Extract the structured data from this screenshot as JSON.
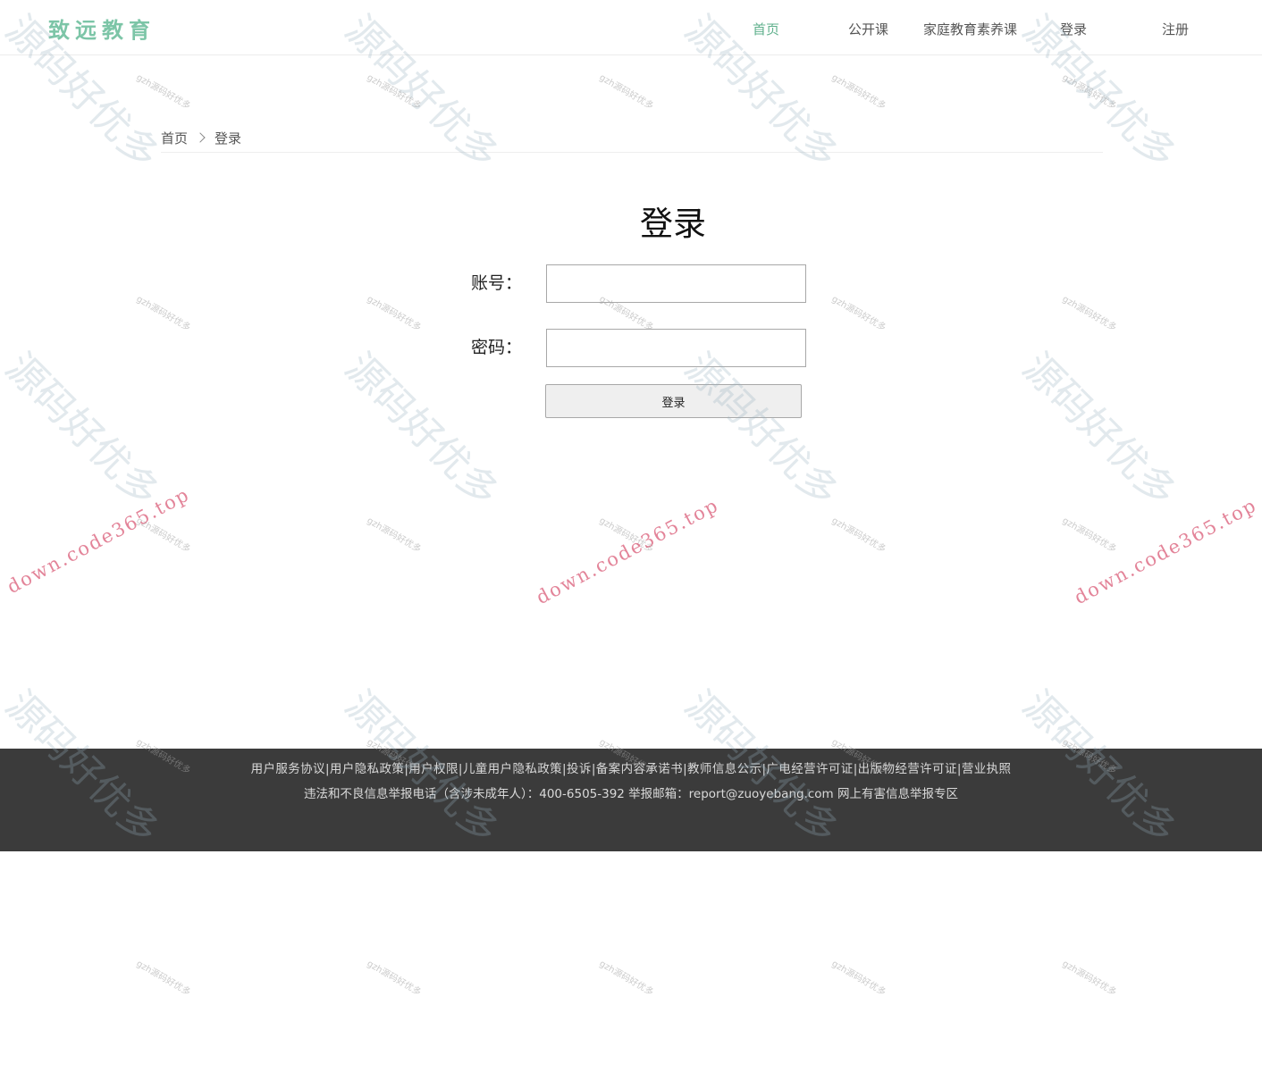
{
  "header": {
    "logo": "致远教育",
    "nav": [
      {
        "label": "首页",
        "active": true
      },
      {
        "label": "公开课",
        "active": false
      },
      {
        "label": "家庭教育素养课",
        "active": false
      },
      {
        "label": "登录",
        "active": false
      },
      {
        "label": "注册",
        "active": false
      }
    ]
  },
  "breadcrumb": {
    "home": "首页",
    "current": "登录"
  },
  "login": {
    "title": "登录",
    "account_label": "账号：",
    "account_value": "",
    "password_label": "密码：",
    "password_value": "",
    "submit_label": "登录"
  },
  "footer": {
    "links": [
      "用户服务协议",
      "用户隐私政策",
      "用户权限",
      "儿童用户隐私政策",
      "投诉",
      "备案内容承诺书",
      "教师信息公示",
      "广电经营许可证",
      "出版物经营许可证",
      "营业执照"
    ],
    "separator": "|",
    "info": "违法和不良信息举报电话（含涉未成年人）：400-6505-392 举报邮箱：report@zuoyebang.com 网上有害信息举报专区"
  },
  "watermarks": {
    "big": "源码好优多",
    "small": "gzh源码好优多",
    "url": "down.code365.top"
  },
  "colors": {
    "accent": "#5fb08c",
    "logo": "#7cc5a7",
    "footer_bg": "#3b3b3b"
  }
}
